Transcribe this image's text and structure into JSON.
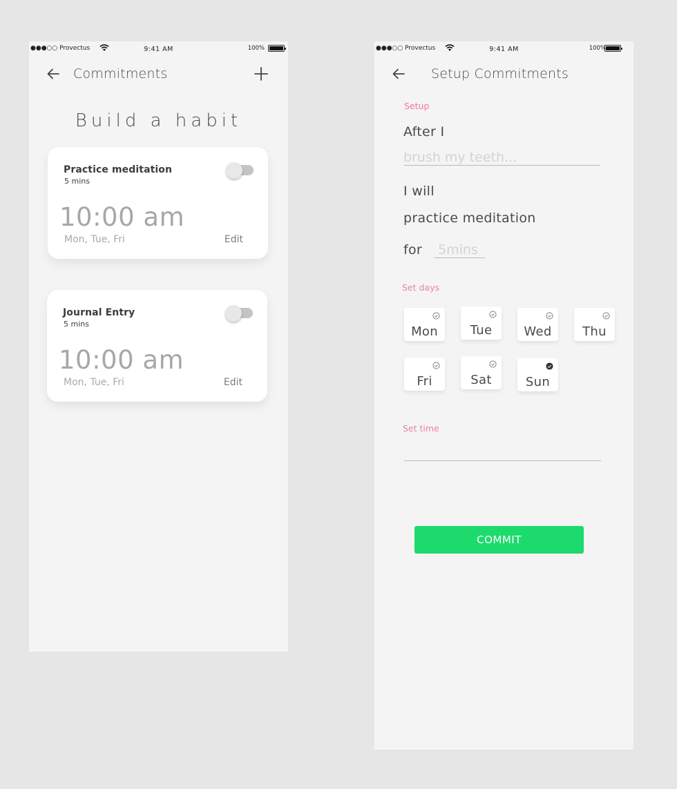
{
  "status_bar": {
    "carrier": "●●●○○ Provectus",
    "time": "9:41 AM",
    "battery_pct": "100%",
    "battery_level": 1.0
  },
  "commitments_screen": {
    "title": "Commitments",
    "back_icon": "arrow-left-icon",
    "add_icon": "plus-icon",
    "headline": "Build a habit",
    "cards": [
      {
        "name": "Practice meditation",
        "duration": "5 mins",
        "time": "10:00 am",
        "days": "Mon, Tue, Fri",
        "edit_label": "Edit",
        "enabled": false
      },
      {
        "name": "Journal Entry",
        "duration": "5 mins",
        "time": "10:00 am",
        "days": "Mon, Tue, Fri",
        "edit_label": "Edit",
        "enabled": false
      }
    ]
  },
  "setup_screen": {
    "title": "Setup Commitments",
    "back_icon": "arrow-left-icon",
    "setup_label": "Setup",
    "after_label": "After I",
    "trigger_placeholder": "brush my teeth...",
    "trigger_value": "",
    "will_label": "I will",
    "habit_text": "practice meditation",
    "for_label": "for",
    "duration_placeholder": "5mins",
    "duration_value": "",
    "days_label": "Set days",
    "days": [
      {
        "label": "Mon",
        "selected": false
      },
      {
        "label": "Tue",
        "selected": false
      },
      {
        "label": "Wed",
        "selected": false
      },
      {
        "label": "Thu",
        "selected": false
      },
      {
        "label": "Fri",
        "selected": false
      },
      {
        "label": "Sat",
        "selected": false
      },
      {
        "label": "Sun",
        "selected": true
      }
    ],
    "time_label": "Set time",
    "time_value": "",
    "commit_label": "COMMIT",
    "accent_color": "#1cdb6c",
    "label_color": "#e8869a"
  }
}
